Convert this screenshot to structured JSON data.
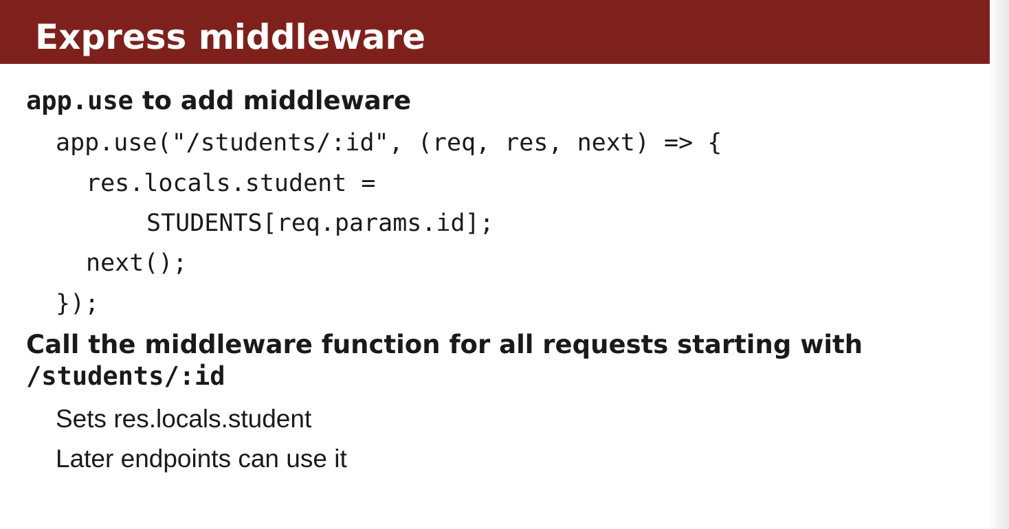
{
  "slide": {
    "title": "Express middleware",
    "heading1": {
      "label_code": "app.use",
      "label_text": " to add middleware"
    },
    "code_lines": [
      "app.use(\"/students/:id\", (req, res, next) => {",
      "res.locals.student =",
      "STUDENTS[req.params.id];",
      "next();",
      "});"
    ],
    "heading2": {
      "line1": "Call the middleware function for all requests starting with",
      "line2_code": "/students/:id"
    },
    "bullets": [
      "Sets res.locals.student",
      "Later endpoints can use it"
    ]
  }
}
